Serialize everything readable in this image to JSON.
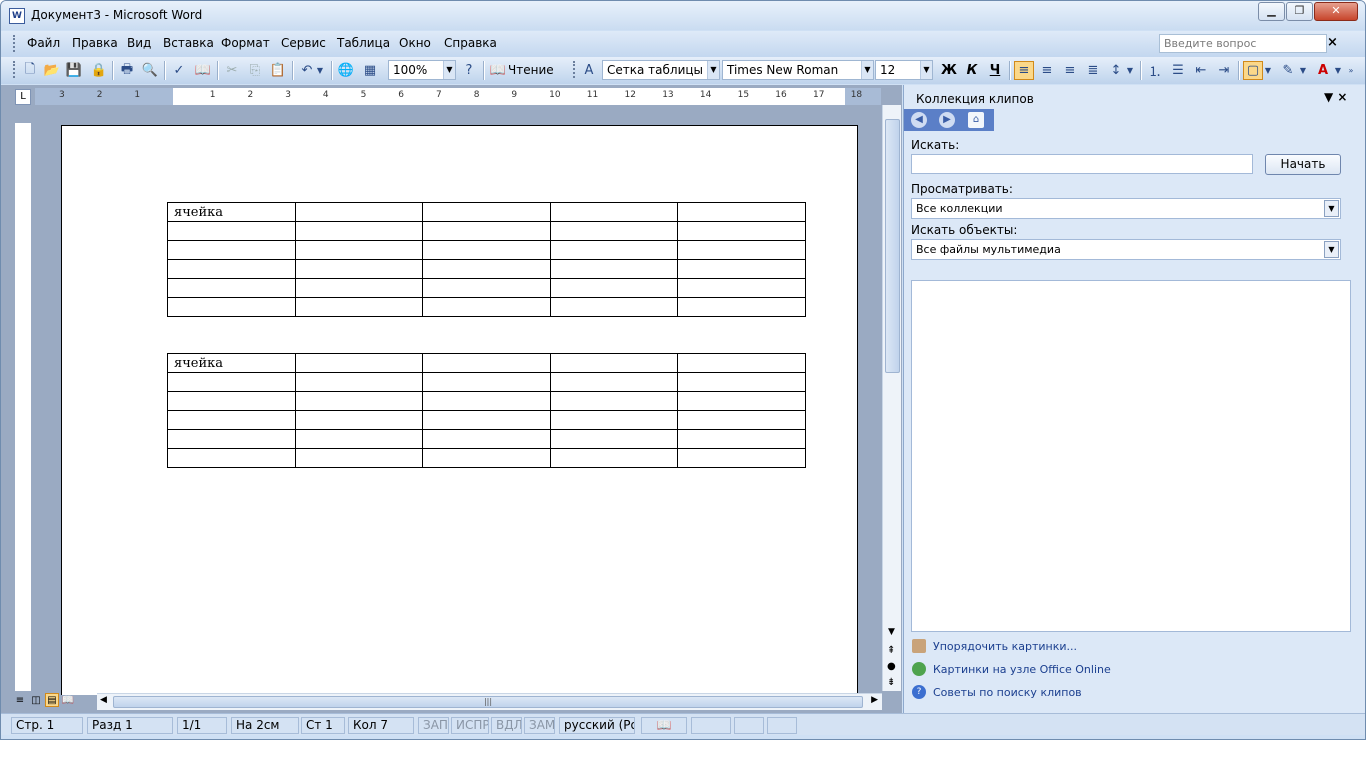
{
  "window": {
    "title": "Документ3 - Microsoft Word"
  },
  "menu": {
    "items": [
      "Файл",
      "Правка",
      "Вид",
      "Вставка",
      "Формат",
      "Сервис",
      "Таблица",
      "Окно",
      "Справка"
    ],
    "ask_placeholder": "Введите вопрос"
  },
  "toolbar": {
    "zoom": "100%",
    "reading": "Чтение",
    "style": "Сетка таблицы",
    "font": "Times New Roman",
    "size": "12",
    "bold": "Ж",
    "italic": "К",
    "underline": "Ч"
  },
  "ruler": {
    "labels": [
      "3",
      "2",
      "1",
      "",
      "1",
      "2",
      "3",
      "4",
      "5",
      "6",
      "7",
      "8",
      "9",
      "10",
      "11",
      "12",
      "13",
      "14",
      "15",
      "16",
      "17",
      "18"
    ]
  },
  "document": {
    "tables": [
      {
        "rows": [
          [
            "ячейка",
            "",
            "",
            "",
            ""
          ],
          [
            "",
            "",
            "",
            "",
            ""
          ],
          [
            "",
            "",
            "",
            "",
            ""
          ],
          [
            "",
            "",
            "",
            "",
            ""
          ],
          [
            "",
            "",
            "",
            "",
            ""
          ],
          [
            "",
            "",
            "",
            "",
            ""
          ]
        ]
      },
      {
        "rows": [
          [
            "ячейка",
            "",
            "",
            "",
            ""
          ],
          [
            "",
            "",
            "",
            "",
            ""
          ],
          [
            "",
            "",
            "",
            "",
            ""
          ],
          [
            "",
            "",
            "",
            "",
            ""
          ],
          [
            "",
            "",
            "",
            "",
            ""
          ],
          [
            "",
            "",
            "",
            "",
            ""
          ]
        ]
      }
    ]
  },
  "status": {
    "page": "Стр. 1",
    "section": "Разд 1",
    "pages": "1/1",
    "at": "На 2см",
    "line": "Ст 1",
    "col": "Кол 7",
    "rec": "ЗАП",
    "trk": "ИСПР",
    "ext": "ВДЛ",
    "ovr": "ЗАМ",
    "lang": "русский (Ро"
  },
  "taskpane": {
    "title": "Коллекция клипов",
    "search_label": "Искать:",
    "search_value": "",
    "start_button": "Начать",
    "browse_label": "Просматривать:",
    "browse_value": "Все коллекции",
    "objects_label": "Искать объекты:",
    "objects_value": "Все файлы мультимедиа",
    "links": [
      "Упорядочить картинки...",
      "Картинки на узле Office Online",
      "Советы по поиску клипов"
    ]
  }
}
